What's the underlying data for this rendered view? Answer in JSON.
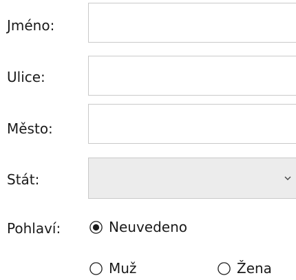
{
  "fields": {
    "name": {
      "label": "Jméno:",
      "value": "",
      "placeholder": ""
    },
    "street": {
      "label": "Ulice:",
      "value": "",
      "placeholder": ""
    },
    "city": {
      "label": "Město:",
      "value": "",
      "placeholder": ""
    },
    "country": {
      "label": "Stát:",
      "selected": ""
    }
  },
  "gender": {
    "label": "Pohlaví:",
    "options": [
      {
        "label": "Neuvedeno",
        "checked": true
      },
      {
        "label": "Muž",
        "checked": false
      },
      {
        "label": "Žena",
        "checked": false
      }
    ]
  },
  "icons": {
    "dropdown": "chevron-down-icon"
  },
  "colors": {
    "border": "#c9c9c9",
    "select_background": "#ececec",
    "text": "#1a1a1a",
    "radio": "#1a1a1a"
  }
}
